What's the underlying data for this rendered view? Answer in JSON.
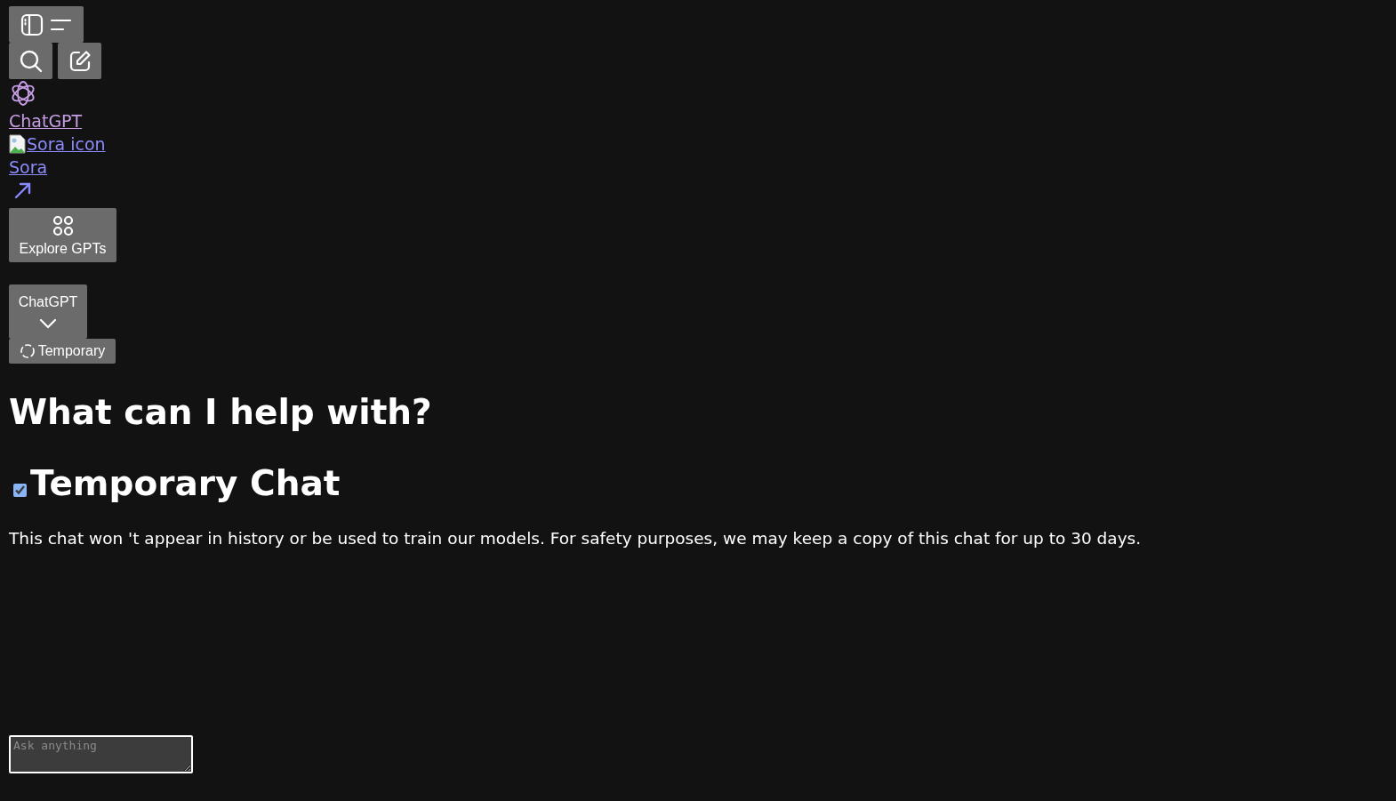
{
  "toolbar": {
    "buttons": [
      {
        "kind": "sidebar"
      },
      {
        "kind": "search"
      },
      {
        "kind": "compose"
      }
    ]
  },
  "nav": {
    "logo_link": "ChatGPT",
    "sora_image_alt": "Sora icon",
    "sora_link": "Sora",
    "explore_button": "Explore GPTs"
  },
  "model_selector": {
    "label": "ChatGPT"
  },
  "temporary_button": {
    "label": "Temporary"
  },
  "main": {
    "heading": "What can I help with?",
    "temporary_chat": {
      "title": "Temporary Chat",
      "checked": true
    },
    "notice": "This chat won 't appear in history or be used to train our models. For safety purposes, we may keep a copy of this chat for up to 30 days."
  },
  "composer": {
    "placeholder": "Ask anything"
  }
}
